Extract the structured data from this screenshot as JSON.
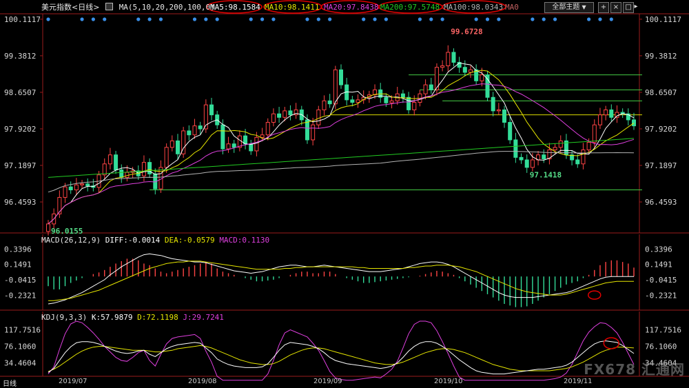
{
  "header": {
    "symbol": "美元指数",
    "period": "<日线>",
    "ma_prefix": "MA(5,10,20,200,100,0)",
    "ma5": "MA5:98.1584",
    "ma10": "MA10:98.1411",
    "ma20": "MA20:97.8438",
    "ma200": "MA200:97.5748",
    "ma100": "MA100:98.0343",
    "ma0": "MA0",
    "main_button": "全部主题",
    "colors": {
      "ma5": "#ffffff",
      "ma10": "#e6e600",
      "ma20": "#e040e0",
      "ma200": "#22cc22",
      "ma100": "#b4b4b4",
      "up": "#ff4444",
      "down": "#33dd99",
      "axis": "#9b1b1b"
    }
  },
  "macd_header": {
    "name": "MACD(26,12,9)",
    "diff": "DIFF:-0.0014",
    "dea": "DEA:-0.0579",
    "macd": "MACD:0.1130"
  },
  "kdj_header": {
    "name": "KDJ(9,3,3)",
    "k": "K:57.9879",
    "d": "D:72.1198",
    "j": "J:29.7241"
  },
  "price_ticks": [
    "100.1117",
    "99.3812",
    "98.6507",
    "97.9202",
    "97.1897",
    "96.4593"
  ],
  "macd_ticks": [
    "0.3396",
    "0.1491",
    "-0.0415",
    "-0.2321"
  ],
  "kdj_ticks": [
    "117.7516",
    "76.1060",
    "34.4604"
  ],
  "time_labels": [
    "2019/07",
    "2019/08",
    "2019/09",
    "2019/10",
    "2019/11"
  ],
  "period_label": "日线",
  "watermark": "FX678 汇通网",
  "chart_data": [
    {
      "type": "candlestick",
      "title": "美元指数",
      "ylim": [
        95.95,
        100.11
      ],
      "ticks": [
        100.1117,
        99.3812,
        98.6507,
        97.9202,
        97.1897,
        96.4593
      ],
      "annotations": [
        {
          "label": "99.6728",
          "value": 99.6728,
          "index": 71
        },
        {
          "label": "97.1418",
          "value": 97.1418,
          "index": 85
        },
        {
          "label": "96.0155",
          "value": 96.0155,
          "index": 0
        }
      ],
      "horizontal_levels": [
        99.0,
        98.7,
        98.48,
        98.2,
        96.7
      ],
      "close": [
        96.02,
        96.22,
        96.55,
        96.76,
        96.7,
        96.8,
        96.82,
        96.78,
        96.75,
        97.0,
        97.22,
        97.4,
        97.1,
        96.95,
        97.05,
        97.08,
        96.98,
        97.25,
        97.02,
        96.72,
        97.15,
        97.55,
        97.68,
        97.42,
        97.88,
        97.8,
        97.98,
        97.92,
        98.4,
        98.2,
        98.0,
        97.52,
        97.62,
        97.55,
        97.78,
        97.62,
        97.48,
        97.75,
        97.8,
        98.05,
        98.22,
        98.15,
        98.28,
        98.2,
        98.3,
        98.1,
        97.7,
        98.0,
        98.3,
        98.48,
        98.42,
        99.1,
        98.8,
        98.5,
        98.45,
        98.5,
        98.55,
        98.6,
        98.7,
        98.55,
        98.44,
        98.48,
        98.62,
        98.55,
        98.3,
        98.45,
        98.62,
        98.8,
        98.7,
        99.15,
        99.18,
        99.45,
        99.25,
        99.15,
        99.05,
        99.1,
        98.88,
        99.0,
        98.55,
        98.28,
        98.3,
        98.05,
        97.7,
        97.35,
        97.3,
        97.15,
        97.3,
        97.4,
        97.32,
        97.5,
        97.55,
        97.68,
        97.4,
        97.3,
        97.22,
        97.5,
        97.65,
        98.0,
        98.2,
        98.3,
        98.15,
        98.25,
        98.22,
        98.1,
        97.98
      ]
    },
    {
      "type": "bar",
      "title": "MACD",
      "ylim": [
        -0.4,
        0.42
      ],
      "ticks": [
        0.3396,
        0.1491,
        -0.0415,
        -0.2321
      ],
      "values": [
        -0.12,
        -0.16,
        -0.16,
        -0.12,
        -0.08,
        -0.05,
        -0.02,
        0.0,
        0.03,
        0.05,
        0.08,
        0.12,
        0.16,
        0.19,
        0.22,
        0.22,
        0.2,
        0.16,
        0.14,
        0.1,
        0.06,
        0.04,
        0.06,
        0.08,
        0.1,
        0.12,
        0.14,
        0.16,
        0.18,
        0.16,
        0.1,
        0.06,
        0.04,
        0.02,
        0.0,
        -0.02,
        -0.04,
        -0.06,
        -0.06,
        -0.05,
        -0.04,
        -0.02,
        0.0,
        0.02,
        0.04,
        0.06,
        0.06,
        0.04,
        0.04,
        0.06,
        0.06,
        0.03,
        0.0,
        -0.02,
        -0.04,
        -0.06,
        -0.08,
        -0.08,
        -0.07,
        -0.06,
        -0.05,
        -0.04,
        -0.03,
        -0.02,
        -0.01,
        0.0,
        0.01,
        0.03,
        0.05,
        0.07,
        0.06,
        0.04,
        0.02,
        -0.02,
        -0.06,
        -0.1,
        -0.14,
        -0.18,
        -0.22,
        -0.26,
        -0.3,
        -0.34,
        -0.36,
        -0.38,
        -0.38,
        -0.37,
        -0.34,
        -0.3,
        -0.26,
        -0.22,
        -0.18,
        -0.14,
        -0.1,
        -0.08,
        -0.06,
        -0.02,
        0.02,
        0.08,
        0.14,
        0.18,
        0.2,
        0.2,
        0.18,
        0.16,
        0.11
      ],
      "diff": [
        -0.34,
        -0.33,
        -0.31,
        -0.29,
        -0.26,
        -0.23,
        -0.2,
        -0.16,
        -0.12,
        -0.08,
        -0.04,
        0.02,
        0.07,
        0.12,
        0.16,
        0.2,
        0.24,
        0.27,
        0.28,
        0.27,
        0.26,
        0.24,
        0.22,
        0.21,
        0.2,
        0.19,
        0.18,
        0.18,
        0.17,
        0.15,
        0.13,
        0.11,
        0.09,
        0.07,
        0.06,
        0.05,
        0.04,
        0.05,
        0.06,
        0.08,
        0.1,
        0.12,
        0.13,
        0.14,
        0.14,
        0.13,
        0.12,
        0.12,
        0.13,
        0.14,
        0.13,
        0.12,
        0.11,
        0.1,
        0.09,
        0.08,
        0.07,
        0.06,
        0.06,
        0.06,
        0.07,
        0.08,
        0.09,
        0.1,
        0.12,
        0.14,
        0.16,
        0.17,
        0.18,
        0.18,
        0.17,
        0.15,
        0.12,
        0.08,
        0.04,
        0.0,
        -0.04,
        -0.08,
        -0.12,
        -0.16,
        -0.2,
        -0.23,
        -0.25,
        -0.26,
        -0.26,
        -0.26,
        -0.26,
        -0.25,
        -0.24,
        -0.23,
        -0.22,
        -0.21,
        -0.2,
        -0.18,
        -0.15,
        -0.12,
        -0.09,
        -0.06,
        -0.03,
        -0.01,
        0.0,
        0.0,
        0.0,
        0.0,
        0.0
      ],
      "dea": [
        -0.3,
        -0.3,
        -0.29,
        -0.28,
        -0.27,
        -0.25,
        -0.23,
        -0.21,
        -0.19,
        -0.17,
        -0.14,
        -0.11,
        -0.08,
        -0.05,
        -0.02,
        0.01,
        0.04,
        0.07,
        0.1,
        0.12,
        0.14,
        0.16,
        0.17,
        0.18,
        0.18,
        0.19,
        0.19,
        0.19,
        0.18,
        0.17,
        0.16,
        0.15,
        0.14,
        0.13,
        0.12,
        0.11,
        0.1,
        0.09,
        0.09,
        0.09,
        0.09,
        0.09,
        0.1,
        0.1,
        0.11,
        0.11,
        0.12,
        0.12,
        0.12,
        0.12,
        0.12,
        0.12,
        0.12,
        0.12,
        0.12,
        0.11,
        0.11,
        0.1,
        0.1,
        0.1,
        0.1,
        0.1,
        0.1,
        0.1,
        0.11,
        0.11,
        0.12,
        0.13,
        0.13,
        0.14,
        0.14,
        0.14,
        0.13,
        0.12,
        0.1,
        0.08,
        0.06,
        0.03,
        0.0,
        -0.03,
        -0.06,
        -0.09,
        -0.12,
        -0.15,
        -0.17,
        -0.19,
        -0.2,
        -0.21,
        -0.22,
        -0.23,
        -0.23,
        -0.23,
        -0.22,
        -0.2,
        -0.18,
        -0.16,
        -0.14,
        -0.12,
        -0.1,
        -0.08,
        -0.07,
        -0.06,
        -0.06,
        -0.06,
        -0.06
      ]
    },
    {
      "type": "line",
      "title": "KDJ",
      "ylim": [
        0,
        140
      ],
      "ticks": [
        117.7516,
        76.106,
        34.4604
      ],
      "series_k": [
        10,
        20,
        40,
        60,
        75,
        85,
        88,
        88,
        86,
        82,
        76,
        70,
        64,
        60,
        58,
        60,
        64,
        66,
        56,
        50,
        60,
        70,
        76,
        80,
        82,
        84,
        86,
        84,
        72,
        60,
        44,
        36,
        30,
        26,
        24,
        22,
        22,
        22,
        24,
        32,
        48,
        66,
        80,
        86,
        84,
        82,
        80,
        76,
        70,
        60,
        48,
        40,
        36,
        32,
        30,
        28,
        26,
        24,
        22,
        20,
        22,
        26,
        34,
        48,
        64,
        76,
        84,
        88,
        88,
        84,
        76,
        66,
        54,
        42,
        32,
        22,
        14,
        10,
        8,
        6,
        6,
        6,
        8,
        10,
        12,
        14,
        16,
        18,
        18,
        20,
        22,
        24,
        28,
        36,
        48,
        60,
        72,
        82,
        88,
        90,
        88,
        86,
        78,
        68,
        58
      ],
      "series_d": [
        12,
        18,
        26,
        36,
        46,
        56,
        64,
        70,
        74,
        76,
        76,
        74,
        72,
        70,
        68,
        66,
        66,
        66,
        64,
        62,
        62,
        64,
        66,
        70,
        72,
        74,
        76,
        78,
        76,
        72,
        66,
        60,
        54,
        48,
        42,
        38,
        34,
        32,
        30,
        30,
        32,
        38,
        46,
        54,
        60,
        66,
        70,
        72,
        72,
        70,
        66,
        62,
        58,
        54,
        50,
        46,
        42,
        38,
        34,
        32,
        30,
        30,
        32,
        36,
        42,
        48,
        54,
        60,
        64,
        68,
        70,
        70,
        68,
        64,
        60,
        54,
        48,
        42,
        36,
        30,
        26,
        22,
        18,
        16,
        14,
        14,
        14,
        14,
        14,
        14,
        16,
        18,
        20,
        24,
        30,
        36,
        44,
        52,
        60,
        66,
        70,
        74,
        74,
        73,
        72
      ],
      "series_j": [
        6,
        24,
        68,
        108,
        133,
        143,
        136,
        124,
        110,
        94,
        76,
        62,
        48,
        40,
        38,
        48,
        60,
        66,
        40,
        26,
        56,
        82,
        96,
        100,
        102,
        104,
        106,
        96,
        64,
        36,
        0,
        -12,
        -18,
        -22,
        -24,
        -26,
        -24,
        -20,
        -12,
        6,
        40,
        80,
        110,
        118,
        112,
        106,
        100,
        84,
        66,
        40,
        12,
        -4,
        -8,
        -12,
        -10,
        -8,
        -6,
        -4,
        -2,
        -4,
        6,
        18,
        38,
        72,
        108,
        132,
        144,
        144,
        136,
        116,
        88,
        58,
        26,
        -2,
        -24,
        -42,
        -54,
        -58,
        -56,
        -54,
        -48,
        -42,
        -36,
        -32,
        -28,
        -24,
        -20,
        -14,
        -12,
        -8,
        -6,
        -2,
        8,
        30,
        60,
        90,
        112,
        126,
        136,
        134,
        124,
        110,
        86,
        58,
        30
      ]
    }
  ]
}
